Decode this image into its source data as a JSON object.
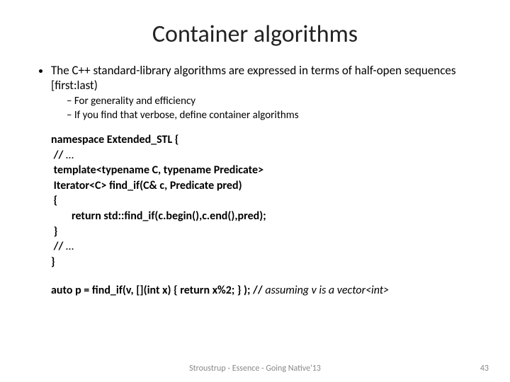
{
  "title": "Container algorithms",
  "bullet1": "The  C++ standard-library algorithms are expressed in terms of half-open sequences [first:last)",
  "sub1": "For generality and efficiency",
  "sub2": "If you find that verbose, define container algorithms",
  "code": {
    "l1": "namespace Extended_STL {",
    "l2a": " // ",
    "l2b": "…",
    "l3": " template<typename C, typename Predicate>",
    "l4": " Iterator<C> find_if(C& c, Predicate pred)",
    "l5": " {",
    "l6": "        return std::find_if(c.begin(),c.end(),pred);",
    "l7": " }",
    "l8a": " // ",
    "l8b": "…",
    "l9": "}"
  },
  "usage_a": "auto p = find_if(v, [](int x) { return x%2; } );  // ",
  "usage_b": "assuming v is a vector<int>",
  "footer": "Stroustrup - Essence - Going Native'13",
  "pagenum": "43"
}
